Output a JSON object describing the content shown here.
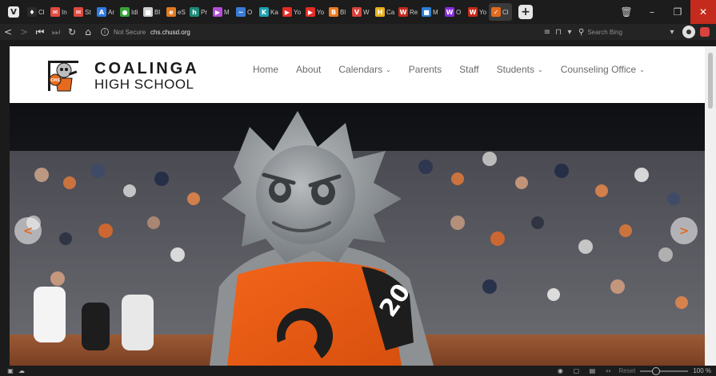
{
  "browser": {
    "tabs": [
      {
        "title": "Cl",
        "color": "#2b2b2b",
        "glyph": "♦"
      },
      {
        "title": "In",
        "color": "#e04a3f",
        "glyph": "✉"
      },
      {
        "title": "St",
        "color": "#e04a3f",
        "glyph": "✉"
      },
      {
        "title": "Ar",
        "color": "#2f7be5",
        "glyph": "A"
      },
      {
        "title": "Idi",
        "color": "#3aa33a",
        "glyph": "●"
      },
      {
        "title": "Bl",
        "color": "#cfcfcf",
        "glyph": "■"
      },
      {
        "title": "eS",
        "color": "#e07b24",
        "glyph": "e"
      },
      {
        "title": "Pr",
        "color": "#1f8a7a",
        "glyph": "h"
      },
      {
        "title": "M",
        "color": "#b14fd8",
        "glyph": "▶"
      },
      {
        "title": "O",
        "color": "#3a7bd5",
        "glyph": "~"
      },
      {
        "title": "Ka",
        "color": "#1fa0b0",
        "glyph": "K"
      },
      {
        "title": "Yo",
        "color": "#e52d27",
        "glyph": "▶"
      },
      {
        "title": "Yo",
        "color": "#e52d27",
        "glyph": "▶"
      },
      {
        "title": "Bl",
        "color": "#f07b1e",
        "glyph": "B"
      },
      {
        "title": "W",
        "color": "#d8443c",
        "glyph": "V"
      },
      {
        "title": "Ca",
        "color": "#e8b21e",
        "glyph": "H"
      },
      {
        "title": "Re",
        "color": "#c42b1c",
        "glyph": "W"
      },
      {
        "title": "M",
        "color": "#2a7fd4",
        "glyph": "■"
      },
      {
        "title": "O",
        "color": "#8a2be2",
        "glyph": "W"
      },
      {
        "title": "Yo",
        "color": "#c42b1c",
        "glyph": "W"
      },
      {
        "title": "Cl",
        "color": "#e56a1e",
        "glyph": "✓"
      }
    ],
    "address": {
      "security": "Not Secure",
      "host": "chs.chusd.org"
    },
    "search_placeholder": "Search Bing",
    "zoom": {
      "reset_label": "Reset",
      "value": "100 %",
      "level": 0.3
    }
  },
  "site": {
    "brand_line1": "COALINGA",
    "brand_line2": "HIGH SCHOOL",
    "logo_text": "CHS",
    "nav": [
      {
        "label": "Home",
        "dropdown": false
      },
      {
        "label": "About",
        "dropdown": false
      },
      {
        "label": "Calendars",
        "dropdown": true
      },
      {
        "label": "Parents",
        "dropdown": false
      },
      {
        "label": "Staff",
        "dropdown": false
      },
      {
        "label": "Students",
        "dropdown": true
      },
      {
        "label": "Counseling Office",
        "dropdown": true
      }
    ],
    "hero": {
      "jersey_letter": "C",
      "jersey_number": "20"
    },
    "colors": {
      "accent": "#e56a1e",
      "nav_text": "#6b6b6b"
    }
  }
}
